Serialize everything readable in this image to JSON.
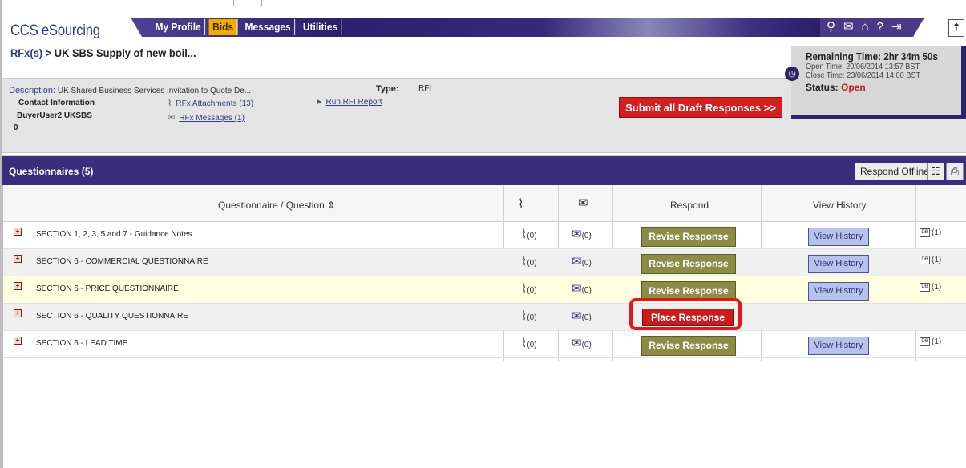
{
  "app": {
    "brand": "CCS eSourcing"
  },
  "nav": {
    "tabs": [
      "My Profile",
      "Bids",
      "Messages",
      "Utilities"
    ],
    "active": "Bids"
  },
  "icons": [
    "search-icon",
    "mail-icon",
    "home-icon",
    "help-icon",
    "logout-icon"
  ],
  "breadcrumb": {
    "link": "RFx(s)",
    "separator": " > ",
    "current": "UK SBS Supply of new boil..."
  },
  "timer": {
    "remaining": "Remaining Time: 2hr 34m 50s",
    "open": "Open Time: 20/06/2014 13:57 BST",
    "close": "Close Time: 23/06/2014 14:00 BST",
    "status_label": "Status:",
    "status_value": "Open"
  },
  "info": {
    "description_label": "Description:",
    "description_value": "UK Shared Business Services Invitation to Quote De...",
    "contact_label": "Contact Information",
    "buyer": "BuyerUser2 UKSBS",
    "contact_extra": "0",
    "type_label": "Type:",
    "type_value": "RFI",
    "attachments_link": "RFx Attachments (13)",
    "messages_link": "RFx Messages (1)",
    "run_report_link": "Run RFI Report",
    "submit_all": "Submit all Draft Responses >>"
  },
  "questionnaires": {
    "title": "Questionnaires (5)",
    "respond_offline": "Respond Offline",
    "columns": {
      "question": "Questionnaire / Question",
      "respond": "Respond",
      "view_history": "View History"
    },
    "rows": [
      {
        "name": "SECTION 1, 2, 3, 5 and 7 - Guidance Notes",
        "attachments": "(0)",
        "messages": "(0)",
        "action": "Revise Response",
        "history": "View History",
        "db_count": "(1)"
      },
      {
        "name": "SECTION 6 - COMMERCIAL QUESTIONNAIRE",
        "attachments": "(0)",
        "messages": "(0)",
        "action": "Revise Response",
        "history": "View History",
        "db_count": "(1)"
      },
      {
        "name": "SECTION 6 - PRICE QUESTIONNAIRE",
        "attachments": "(0)",
        "messages": "(0)",
        "action": "Revise Response",
        "history": "View History",
        "db_count": "(1)"
      },
      {
        "name": "SECTION 6 - QUALITY QUESTIONNAIRE",
        "attachments": "(0)",
        "messages": "(0)",
        "action": "Place Response",
        "history": "",
        "db_count": ""
      },
      {
        "name": "SECTION 6 - LEAD TIME",
        "attachments": "(0)",
        "messages": "(0)",
        "action": "Revise Response",
        "history": "View History",
        "db_count": "(1)"
      }
    ]
  },
  "colors": {
    "nav_band": "#2c1f6e",
    "active_tab": "#f2a900",
    "submit_red": "#d21f1f",
    "revise_olive": "#8d8b46",
    "place_red": "#c91d1d",
    "view_history_blue": "#b7c3ec",
    "highlight_ring": "#e3161a"
  }
}
